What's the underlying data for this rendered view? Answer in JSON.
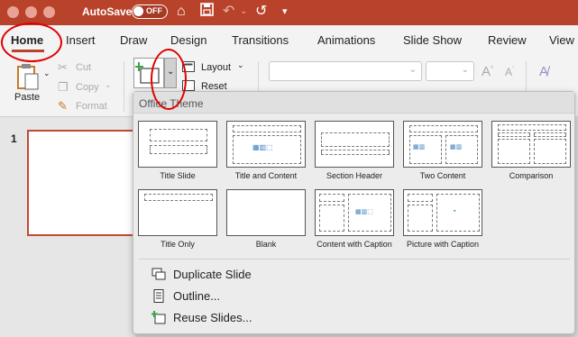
{
  "titlebar": {
    "autosave_label": "AutoSave",
    "toggle_state": "OFF"
  },
  "tabs": [
    "Home",
    "Insert",
    "Draw",
    "Design",
    "Transitions",
    "Animations",
    "Slide Show",
    "Review",
    "View"
  ],
  "ribbon": {
    "paste": "Paste",
    "cut": "Cut",
    "copy": "Copy",
    "format": "Format",
    "layout": "Layout",
    "reset": "Reset"
  },
  "slide_panel": {
    "slide_number": "1"
  },
  "gallery": {
    "header": "Office Theme",
    "layouts": [
      "Title Slide",
      "Title and Content",
      "Section Header",
      "Two Content",
      "Comparison",
      "Title Only",
      "Blank",
      "Content with Caption",
      "Picture with Caption"
    ],
    "menu": [
      "Duplicate Slide",
      "Outline...",
      "Reuse Slides..."
    ]
  },
  "colors": {
    "accent": "#b9422b",
    "annotation": "#e00000"
  }
}
